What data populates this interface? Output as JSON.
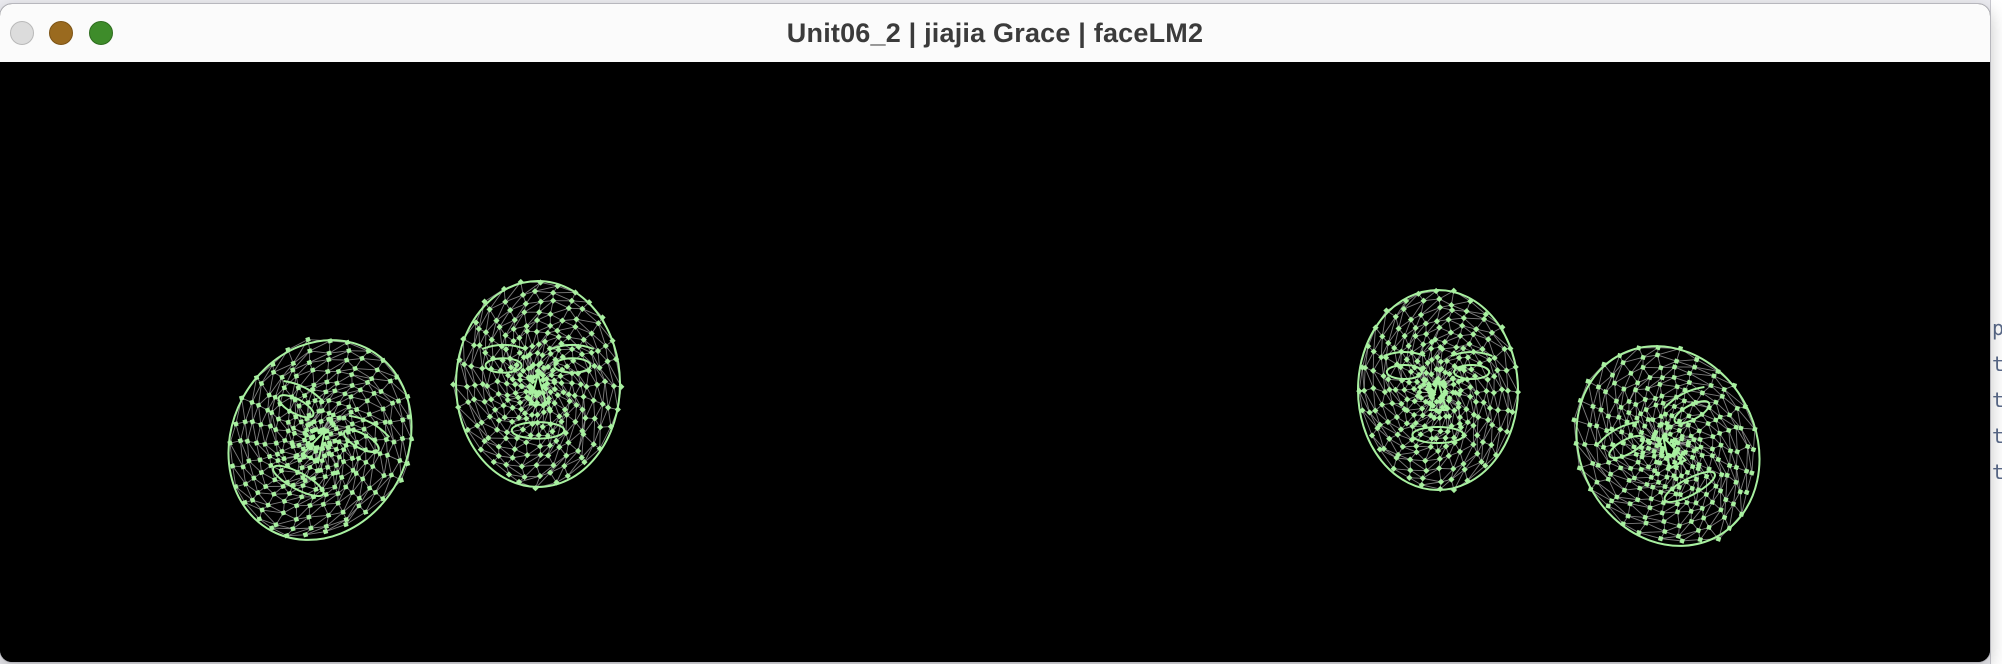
{
  "window": {
    "title": "Unit06_2 | jiajia Grace | faceLM2"
  },
  "traffic_lights": {
    "close": "close-button",
    "minimize": "minimize-button",
    "zoom": "zoom-button"
  },
  "canvas": {
    "background": "#000000",
    "mesh_color": "#a8f0a0",
    "line_color": "#b0b0b0"
  },
  "background_window": {
    "glyphs": [
      "p",
      "t",
      "t",
      "t",
      "t"
    ]
  }
}
